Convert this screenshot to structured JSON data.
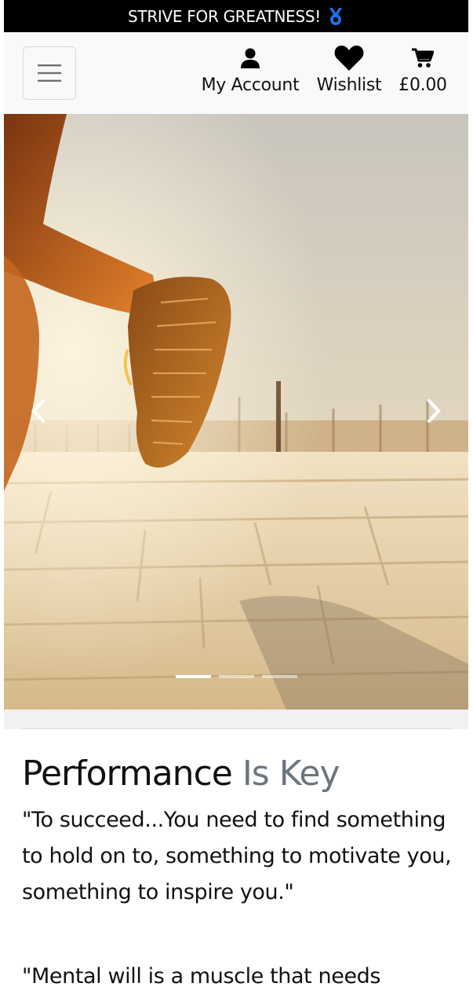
{
  "banner": {
    "text": "STRIVE FOR GREATNESS!",
    "icon": "medal-icon"
  },
  "nav": {
    "toggler_icon": "hamburger-menu-icon",
    "account": {
      "label": "My Account",
      "icon": "user-icon"
    },
    "wishlist": {
      "label": "Wishlist",
      "icon": "heart-icon"
    },
    "cart": {
      "label": "£0.00",
      "icon": "cart-icon"
    }
  },
  "carousel": {
    "image_alt": "runner shoe on brick path",
    "slides": 3,
    "active_slide": 1,
    "prev_icon": "chevron-left-icon",
    "next_icon": "chevron-right-icon"
  },
  "section": {
    "heading_main": "Performance",
    "heading_muted": "Is Key",
    "quote1": "\"To succeed...You need to find something to hold on to, something to motivate you, something to inspire you.\"",
    "quote2": "\"Mental will is a muscle that needs"
  },
  "colors": {
    "banner_bg": "#000000",
    "navbar_bg": "#f8f9fa",
    "muted_text": "#6c757d",
    "medal_blue": "#1a73e8"
  }
}
